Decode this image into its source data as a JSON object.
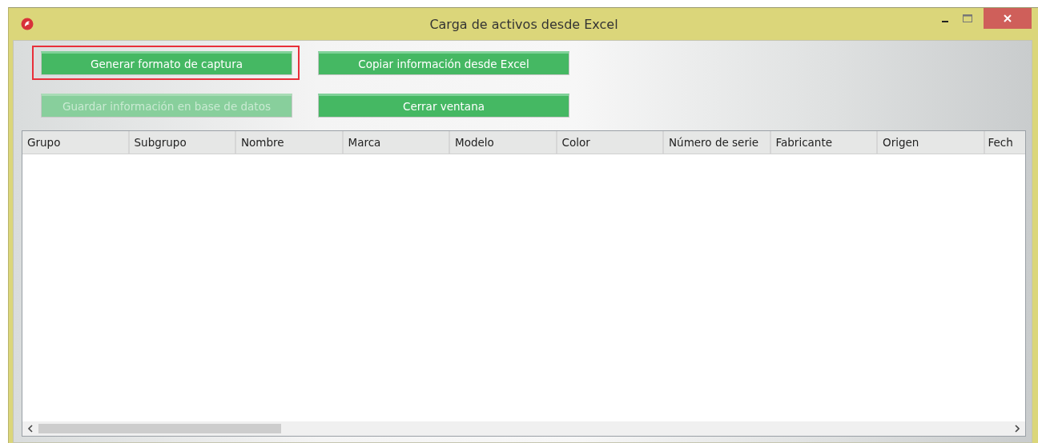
{
  "window": {
    "title": "Carga de activos desde Excel"
  },
  "buttons": [
    {
      "label": "Generar formato de captura",
      "disabled": false,
      "highlighted": true
    },
    {
      "label": "Copiar información desde Excel",
      "disabled": false,
      "highlighted": false
    },
    {
      "label": "Guardar información en base de datos",
      "disabled": true,
      "highlighted": false
    },
    {
      "label": "Cerrar ventana",
      "disabled": false,
      "highlighted": false
    }
  ],
  "table": {
    "columns": [
      "Grupo",
      "Subgrupo",
      "Nombre",
      "Marca",
      "Modelo",
      "Color",
      "Número de serie",
      "Fabricante",
      "Origen",
      "Fech"
    ]
  }
}
